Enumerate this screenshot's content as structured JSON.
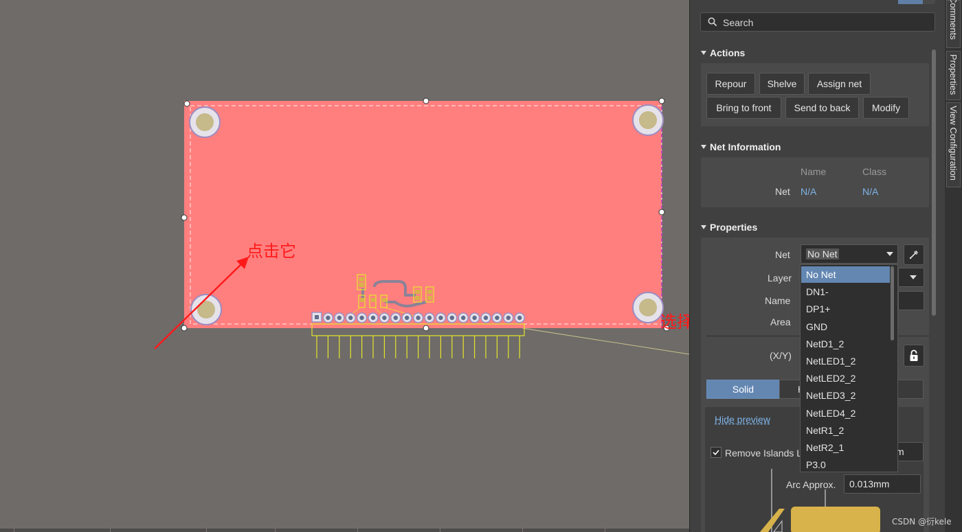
{
  "annotations": {
    "click_it": "点击它",
    "choose_gnd": "选择GND"
  },
  "search": {
    "placeholder": "Search"
  },
  "actions": {
    "title": "Actions",
    "repour": "Repour",
    "shelve": "Shelve",
    "assign_net": "Assign net",
    "bring_to_front": "Bring to front",
    "send_to_back": "Send to back",
    "modify": "Modify"
  },
  "net_info": {
    "title": "Net Information",
    "col_name": "Name",
    "col_class": "Class",
    "row_label": "Net",
    "name_value": "N/A",
    "class_value": "N/A"
  },
  "properties": {
    "title": "Properties",
    "net_label": "Net",
    "net_value": "No Net",
    "layer_label": "Layer",
    "name_label": "Name",
    "area_label": "Area",
    "xy_label": "(X/Y)",
    "fill_solid": "Solid",
    "fill_hatched_partial": "H",
    "hide_preview": "Hide preview",
    "remove_islands_partial": "Remove Islands Le",
    "remove_islands_unit_partial": "m",
    "arc_approx_partial": "Arc Approx.",
    "arc_approx_value": "0.013mm",
    "remove_islands_checked": true
  },
  "net_options": [
    "No Net",
    "DN1-",
    "DP1+",
    "GND",
    "NetD1_2",
    "NetLED1_2",
    "NetLED2_2",
    "NetLED3_2",
    "NetLED4_2",
    "NetR1_2",
    "NetR2_1",
    "P3.0"
  ],
  "selected_net": "No Net",
  "side_tabs": [
    "Comments",
    "Properties",
    "View Configuration"
  ],
  "watermark": "CSDN @衍kele",
  "colors": {
    "polygon_fill": "#ff7f7f",
    "selection_accent": "#6487b2",
    "annotation_red": "#ff1a1a",
    "silkscreen": "#e6e62a",
    "link_blue": "#7fb4e8"
  },
  "icons": [
    "search-icon",
    "collapse-triangle-icon",
    "dropdown-caret-icon",
    "eyedropper-icon",
    "lock-icon",
    "checkbox-icon"
  ]
}
